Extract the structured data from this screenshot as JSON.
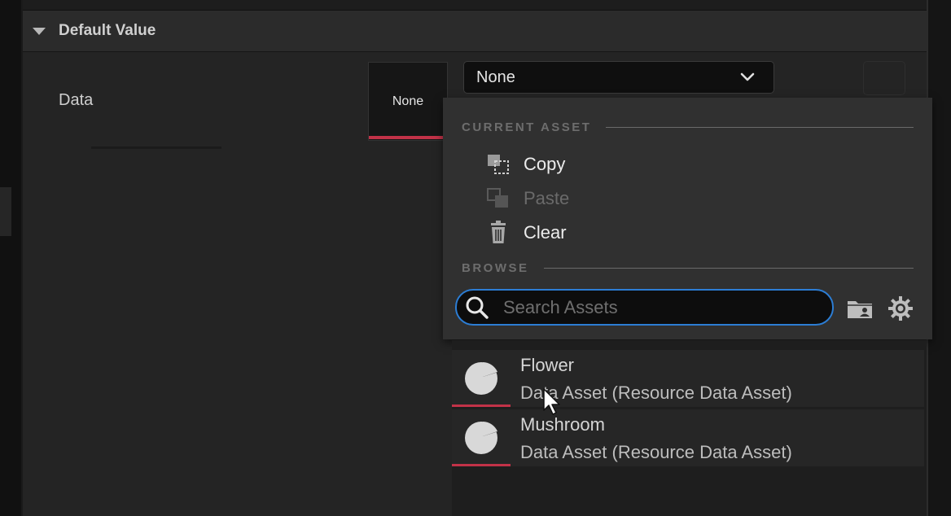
{
  "section": {
    "title": "Default Value"
  },
  "property": {
    "label": "Data",
    "thumbnail_text": "None",
    "selected_value": "None"
  },
  "dropdown": {
    "current_asset_header": "CURRENT ASSET",
    "actions": [
      {
        "label": "Copy",
        "icon": "copy-icon",
        "enabled": true
      },
      {
        "label": "Paste",
        "icon": "paste-icon",
        "enabled": false
      },
      {
        "label": "Clear",
        "icon": "trash-icon",
        "enabled": true
      }
    ],
    "browse_header": "BROWSE",
    "search": {
      "placeholder": "Search Assets",
      "value": ""
    },
    "tool_icons": [
      "folder-icon",
      "settings-gear-icon"
    ]
  },
  "assets": [
    {
      "name": "Flower",
      "type": "Data Asset (Resource Data Asset)",
      "icon": "data-asset-pie-icon"
    },
    {
      "name": "Mushroom",
      "type": "Data Asset (Resource Data Asset)",
      "icon": "data-asset-pie-icon"
    }
  ],
  "colors": {
    "accent_bar": "#c23248",
    "search_focus": "#2c7dd4",
    "panel_bg": "#242424",
    "menu_bg": "#303030"
  }
}
